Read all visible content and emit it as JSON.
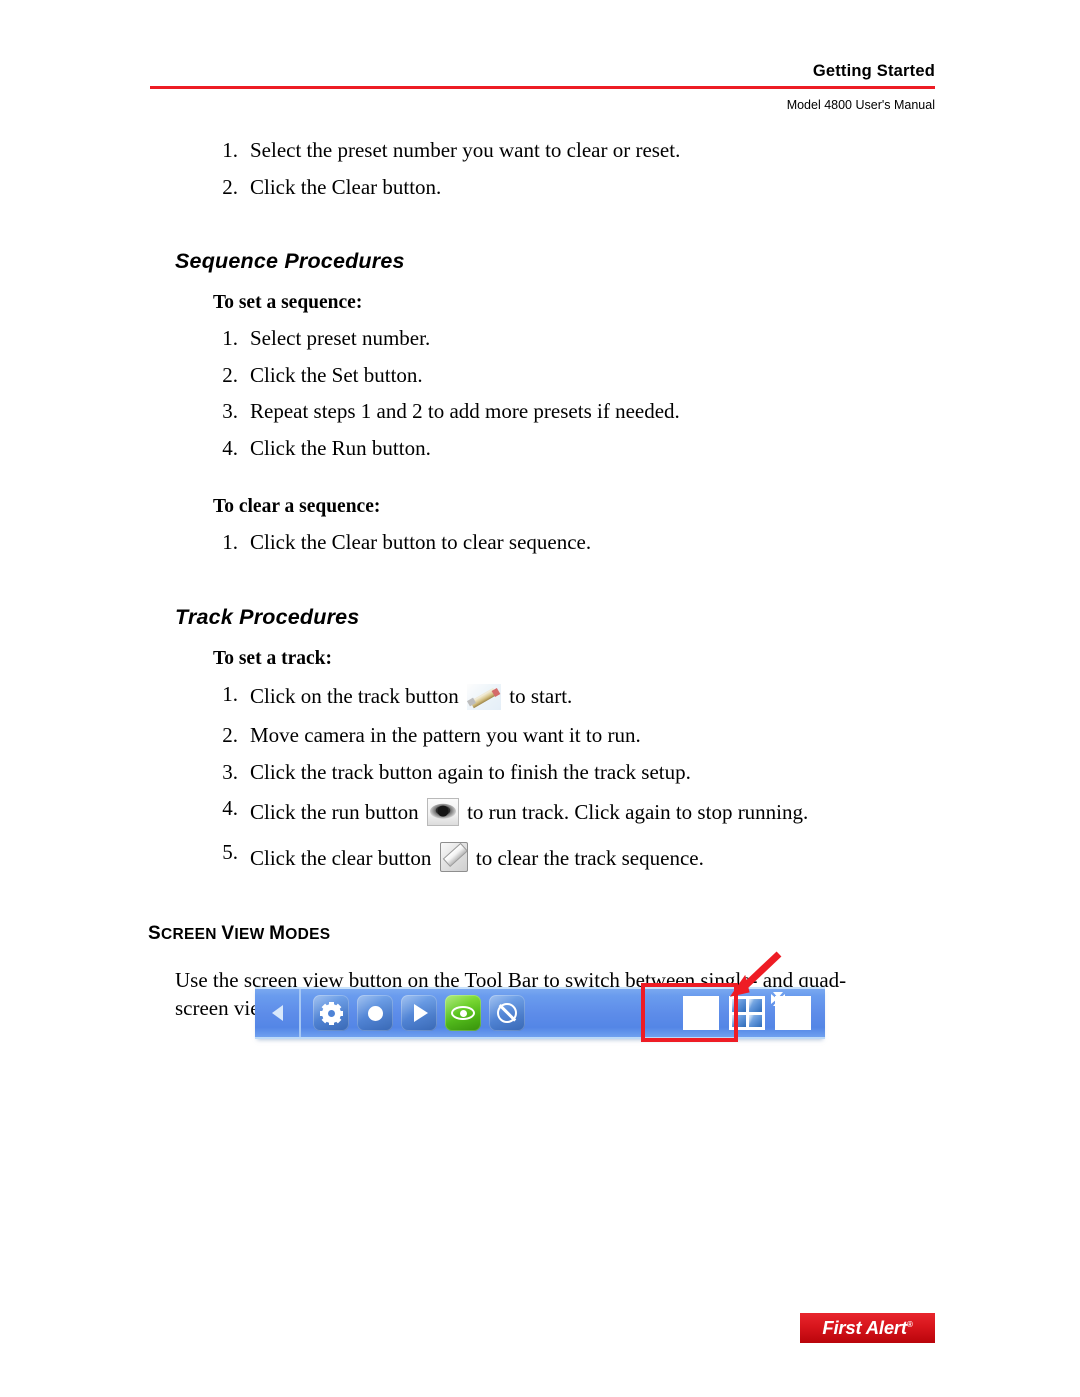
{
  "header": {
    "title": "Getting Started",
    "subtitle": "Model 4800 User's Manual",
    "rule_color": "#ed1c24"
  },
  "preset_steps": [
    {
      "num": "1.",
      "text": "Select the preset number you want to clear or reset."
    },
    {
      "num": "2.",
      "text": "Click the Clear button."
    }
  ],
  "sequence_section": {
    "heading": "Sequence Procedures",
    "set_subheading": "To set a sequence:",
    "set_steps": [
      {
        "num": "1.",
        "text": "Select preset number."
      },
      {
        "num": "2.",
        "text": "Click the Set button."
      },
      {
        "num": "3.",
        "text": "Repeat steps 1 and 2 to add more presets if needed."
      },
      {
        "num": "4.",
        "text": "Click the Run button."
      }
    ],
    "clear_subheading": "To clear a sequence:",
    "clear_steps": [
      {
        "num": "1.",
        "text": "Click the Clear button to clear sequence."
      }
    ]
  },
  "track_section": {
    "heading": "Track Procedures",
    "set_subheading": "To set a track:",
    "steps": [
      {
        "num": "1.",
        "text_before": "Click on the track button",
        "icon": "pencil-track-icon",
        "text_after": "to start."
      },
      {
        "num": "2.",
        "text_before": "Move camera in the pattern you want it to run.",
        "icon": null,
        "text_after": ""
      },
      {
        "num": "3.",
        "text_before": "Click the track button again to finish the track setup.",
        "icon": null,
        "text_after": ""
      },
      {
        "num": "4.",
        "text_before": "Click the run button",
        "icon": "eye-run-icon",
        "text_after": "to run track. Click again to stop running."
      },
      {
        "num": "5.",
        "text_before": "Click the clear button",
        "icon": "eraser-clear-icon",
        "text_after": "to clear the track sequence."
      }
    ]
  },
  "screen_view_section": {
    "heading_first": "S",
    "heading_rest1": "CREEN ",
    "heading_cap2": "V",
    "heading_rest2": "IEW ",
    "heading_cap3": "M",
    "heading_rest3": "ODES",
    "heading_full": "SCREEN VIEW MODES",
    "paragraph": "Use the screen view button on the Tool Bar to switch between single- and quad-screen views."
  },
  "toolbar": {
    "collapse_label": "collapse-arrow",
    "buttons": [
      {
        "name": "settings-gear-button",
        "glyph": "gear-icon",
        "state": "normal"
      },
      {
        "name": "record-button",
        "glyph": "record-dot-icon",
        "state": "normal"
      },
      {
        "name": "play-button",
        "glyph": "play-triangle-icon",
        "state": "normal"
      },
      {
        "name": "track-run-button",
        "glyph": "eye-icon",
        "state": "active-green"
      },
      {
        "name": "clear-disable-button",
        "glyph": "no-symbol-icon",
        "state": "normal"
      }
    ],
    "view_buttons": [
      {
        "name": "single-screen-view-button",
        "glyph": "single-pane-icon",
        "highlighted": true
      },
      {
        "name": "quad-screen-view-button",
        "glyph": "quad-pane-icon",
        "highlighted": true
      },
      {
        "name": "pan-expand-button",
        "glyph": "four-arrows-icon",
        "highlighted": false
      }
    ],
    "highlight_color": "#ee1c25",
    "bar_color": "#5d8ce9",
    "active_color": "#4fc012"
  },
  "footer": {
    "logo_text": "First Alert",
    "logo_registered": "®",
    "logo_bg": "#d8151c"
  }
}
